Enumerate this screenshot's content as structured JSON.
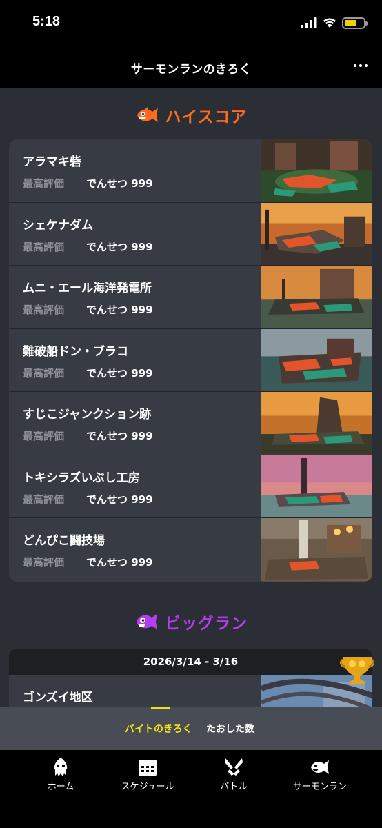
{
  "status_bar": {
    "time": "5:18"
  },
  "header": {
    "title": "サーモンランのきろく"
  },
  "high_score": {
    "heading": "ハイスコア",
    "stages": [
      {
        "name": "アラマキ砦",
        "grade_label": "最高評価",
        "grade_value": "でんせつ 999"
      },
      {
        "name": "シェケナダム",
        "grade_label": "最高評価",
        "grade_value": "でんせつ 999"
      },
      {
        "name": "ムニ・エール海洋発電所",
        "grade_label": "最高評価",
        "grade_value": "でんせつ 999"
      },
      {
        "name": "難破船ドン・ブラコ",
        "grade_label": "最高評価",
        "grade_value": "でんせつ 999"
      },
      {
        "name": "すじこジャンクション跡",
        "grade_label": "最高評価",
        "grade_value": "でんせつ 999"
      },
      {
        "name": "トキシラズいぶし工房",
        "grade_label": "最高評価",
        "grade_value": "でんせつ 999"
      },
      {
        "name": "どんぴこ闘技場",
        "grade_label": "最高評価",
        "grade_value": "でんせつ 999"
      }
    ]
  },
  "big_run": {
    "heading": "ビッグラン",
    "date": "2026/3/14 - 3/16",
    "stage": "ゴンズイ地区"
  },
  "sub_tabs": [
    "バイトのきろく",
    "たおした数"
  ],
  "bottom_nav": [
    {
      "label": "ホーム",
      "icon": "squid-icon"
    },
    {
      "label": "スケジュール",
      "icon": "calendar-icon"
    },
    {
      "label": "バトル",
      "icon": "battle-icon"
    },
    {
      "label": "サーモンラン",
      "icon": "salmon-icon"
    }
  ],
  "colors": {
    "high_score_accent": "#ff6a1f",
    "big_run_accent": "#b63cf0",
    "tab_active": "#f5e11a"
  }
}
